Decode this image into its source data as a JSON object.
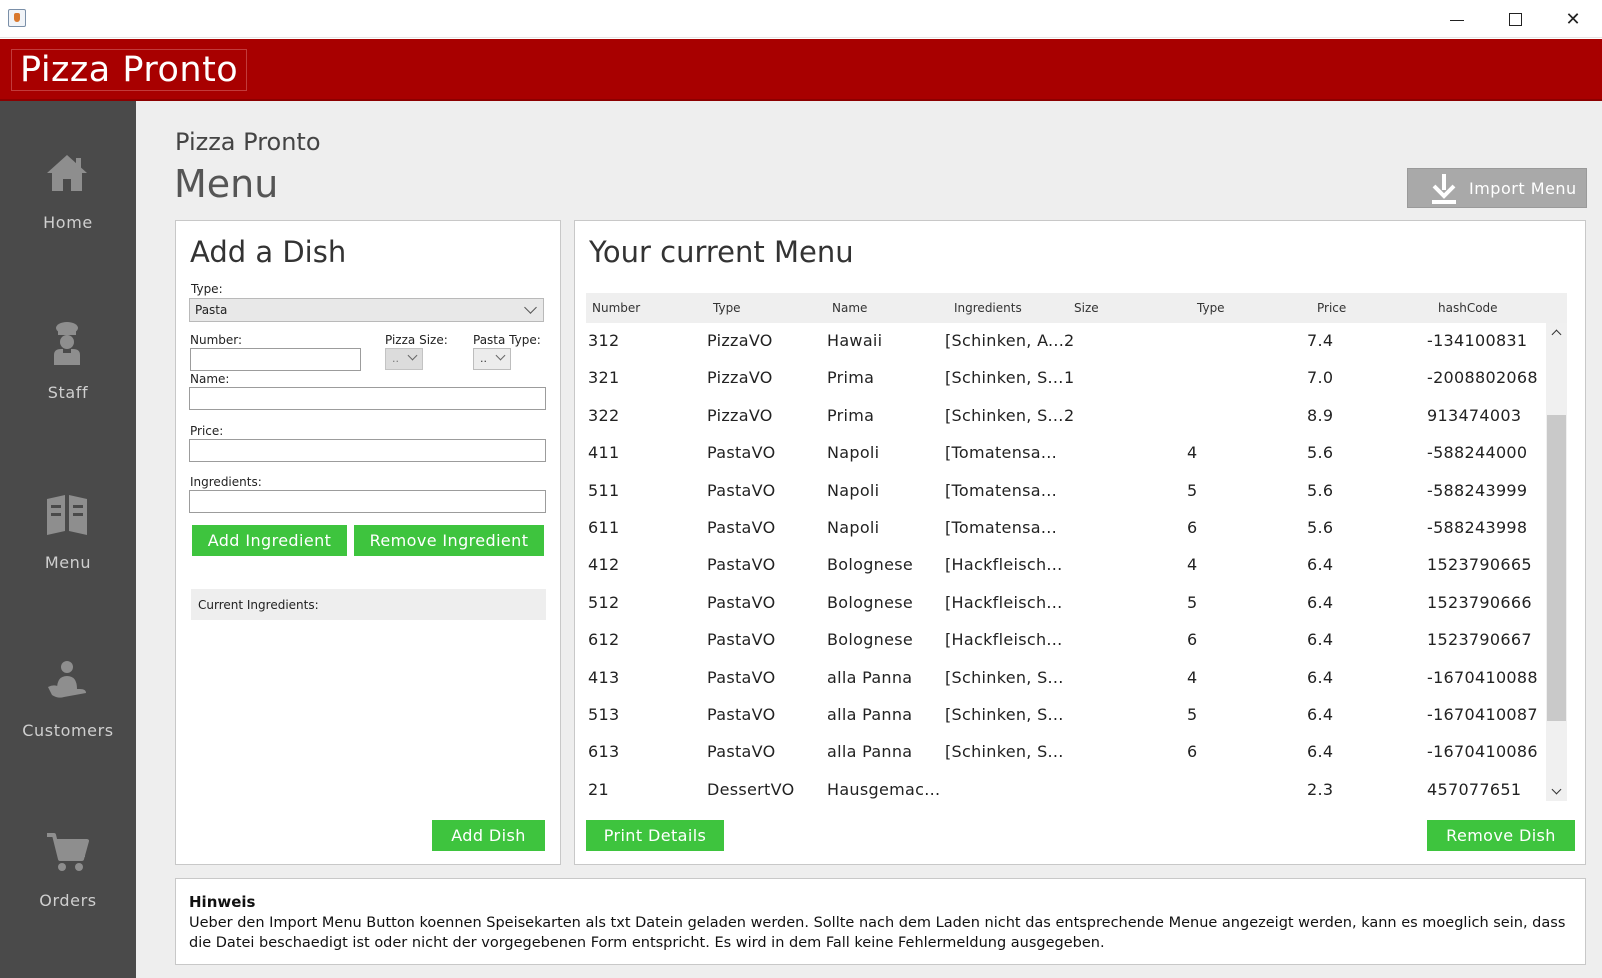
{
  "window": {
    "close_glyph": "✕"
  },
  "header": {
    "brand": "Pizza Pronto",
    "color": "#a80000"
  },
  "sidebar": {
    "items": [
      {
        "label": "Home",
        "icon": "home-icon"
      },
      {
        "label": "Staff",
        "icon": "chef-icon"
      },
      {
        "label": "Menu",
        "icon": "menu-book-icon"
      },
      {
        "label": "Customers",
        "icon": "customer-icon"
      },
      {
        "label": "Orders",
        "icon": "cart-icon"
      }
    ]
  },
  "page": {
    "subtitle": "Pizza Pronto",
    "title": "Menu",
    "import_label": "Import Menu"
  },
  "add_dish": {
    "title": "Add a Dish",
    "type_label": "Type:",
    "type_value": "Pasta",
    "number_label": "Number:",
    "pizza_size_label": "Pizza Size:",
    "pizza_size_value": "..",
    "pasta_type_label": "Pasta Type:",
    "pasta_type_value": "..",
    "name_label": "Name:",
    "price_label": "Price:",
    "ingredients_label": "Ingredients:",
    "add_ingredient": "Add Ingredient",
    "remove_ingredient": "Remove Ingredient",
    "current_ingredients": "Current Ingredients:",
    "add_dish": "Add Dish"
  },
  "menu": {
    "title": "Your current Menu",
    "columns": [
      "Number",
      "Type",
      "Name",
      "Ingredients",
      "Size",
      "Type",
      "Price",
      "hashCode"
    ],
    "rows": [
      [
        "312",
        "PizzaVO",
        "Hawaii",
        "[Schinken, A...",
        "2",
        "",
        "7.4",
        "-134100831"
      ],
      [
        "321",
        "PizzaVO",
        "Prima",
        "[Schinken, S...",
        "1",
        "",
        "7.0",
        "-2008802068"
      ],
      [
        "322",
        "PizzaVO",
        "Prima",
        "[Schinken, S...",
        "2",
        "",
        "8.9",
        "913474003"
      ],
      [
        "411",
        "PastaVO",
        "Napoli",
        "[Tomatensa...",
        "",
        "4",
        "5.6",
        "-588244000"
      ],
      [
        "511",
        "PastaVO",
        "Napoli",
        "[Tomatensa...",
        "",
        "5",
        "5.6",
        "-588243999"
      ],
      [
        "611",
        "PastaVO",
        "Napoli",
        "[Tomatensa...",
        "",
        "6",
        "5.6",
        "-588243998"
      ],
      [
        "412",
        "PastaVO",
        "Bolognese",
        "[Hackfleisch...",
        "",
        "4",
        "6.4",
        "1523790665"
      ],
      [
        "512",
        "PastaVO",
        "Bolognese",
        "[Hackfleisch...",
        "",
        "5",
        "6.4",
        "1523790666"
      ],
      [
        "612",
        "PastaVO",
        "Bolognese",
        "[Hackfleisch...",
        "",
        "6",
        "6.4",
        "1523790667"
      ],
      [
        "413",
        "PastaVO",
        "alla Panna",
        "[Schinken, S...",
        "",
        "4",
        "6.4",
        "-1670410088"
      ],
      [
        "513",
        "PastaVO",
        "alla Panna",
        "[Schinken, S...",
        "",
        "5",
        "6.4",
        "-1670410087"
      ],
      [
        "613",
        "PastaVO",
        "alla Panna",
        "[Schinken, S...",
        "",
        "6",
        "6.4",
        "-1670410086"
      ],
      [
        "21",
        "DessertVO",
        "Hausgemac...",
        "",
        "",
        "",
        "2.3",
        "457077651"
      ]
    ],
    "print_details": "Print Details",
    "remove_dish": "Remove Dish"
  },
  "hint": {
    "title": "Hinweis",
    "text": "Ueber den Import Menu Button koennen Speisekarten als txt Datein geladen werden. Sollte nach dem Laden nicht das entsprechende Menue angezeigt werden, kann es moeglich sein, dass die Datei beschaedigt ist oder nicht der vorgegebenen Form entspricht. Es wird in dem Fall keine Fehlermeldung ausgegeben."
  },
  "colors": {
    "accent_green": "#3ec43e",
    "sidebar": "#4a4a4a",
    "import_button": "#a9a9a9"
  }
}
